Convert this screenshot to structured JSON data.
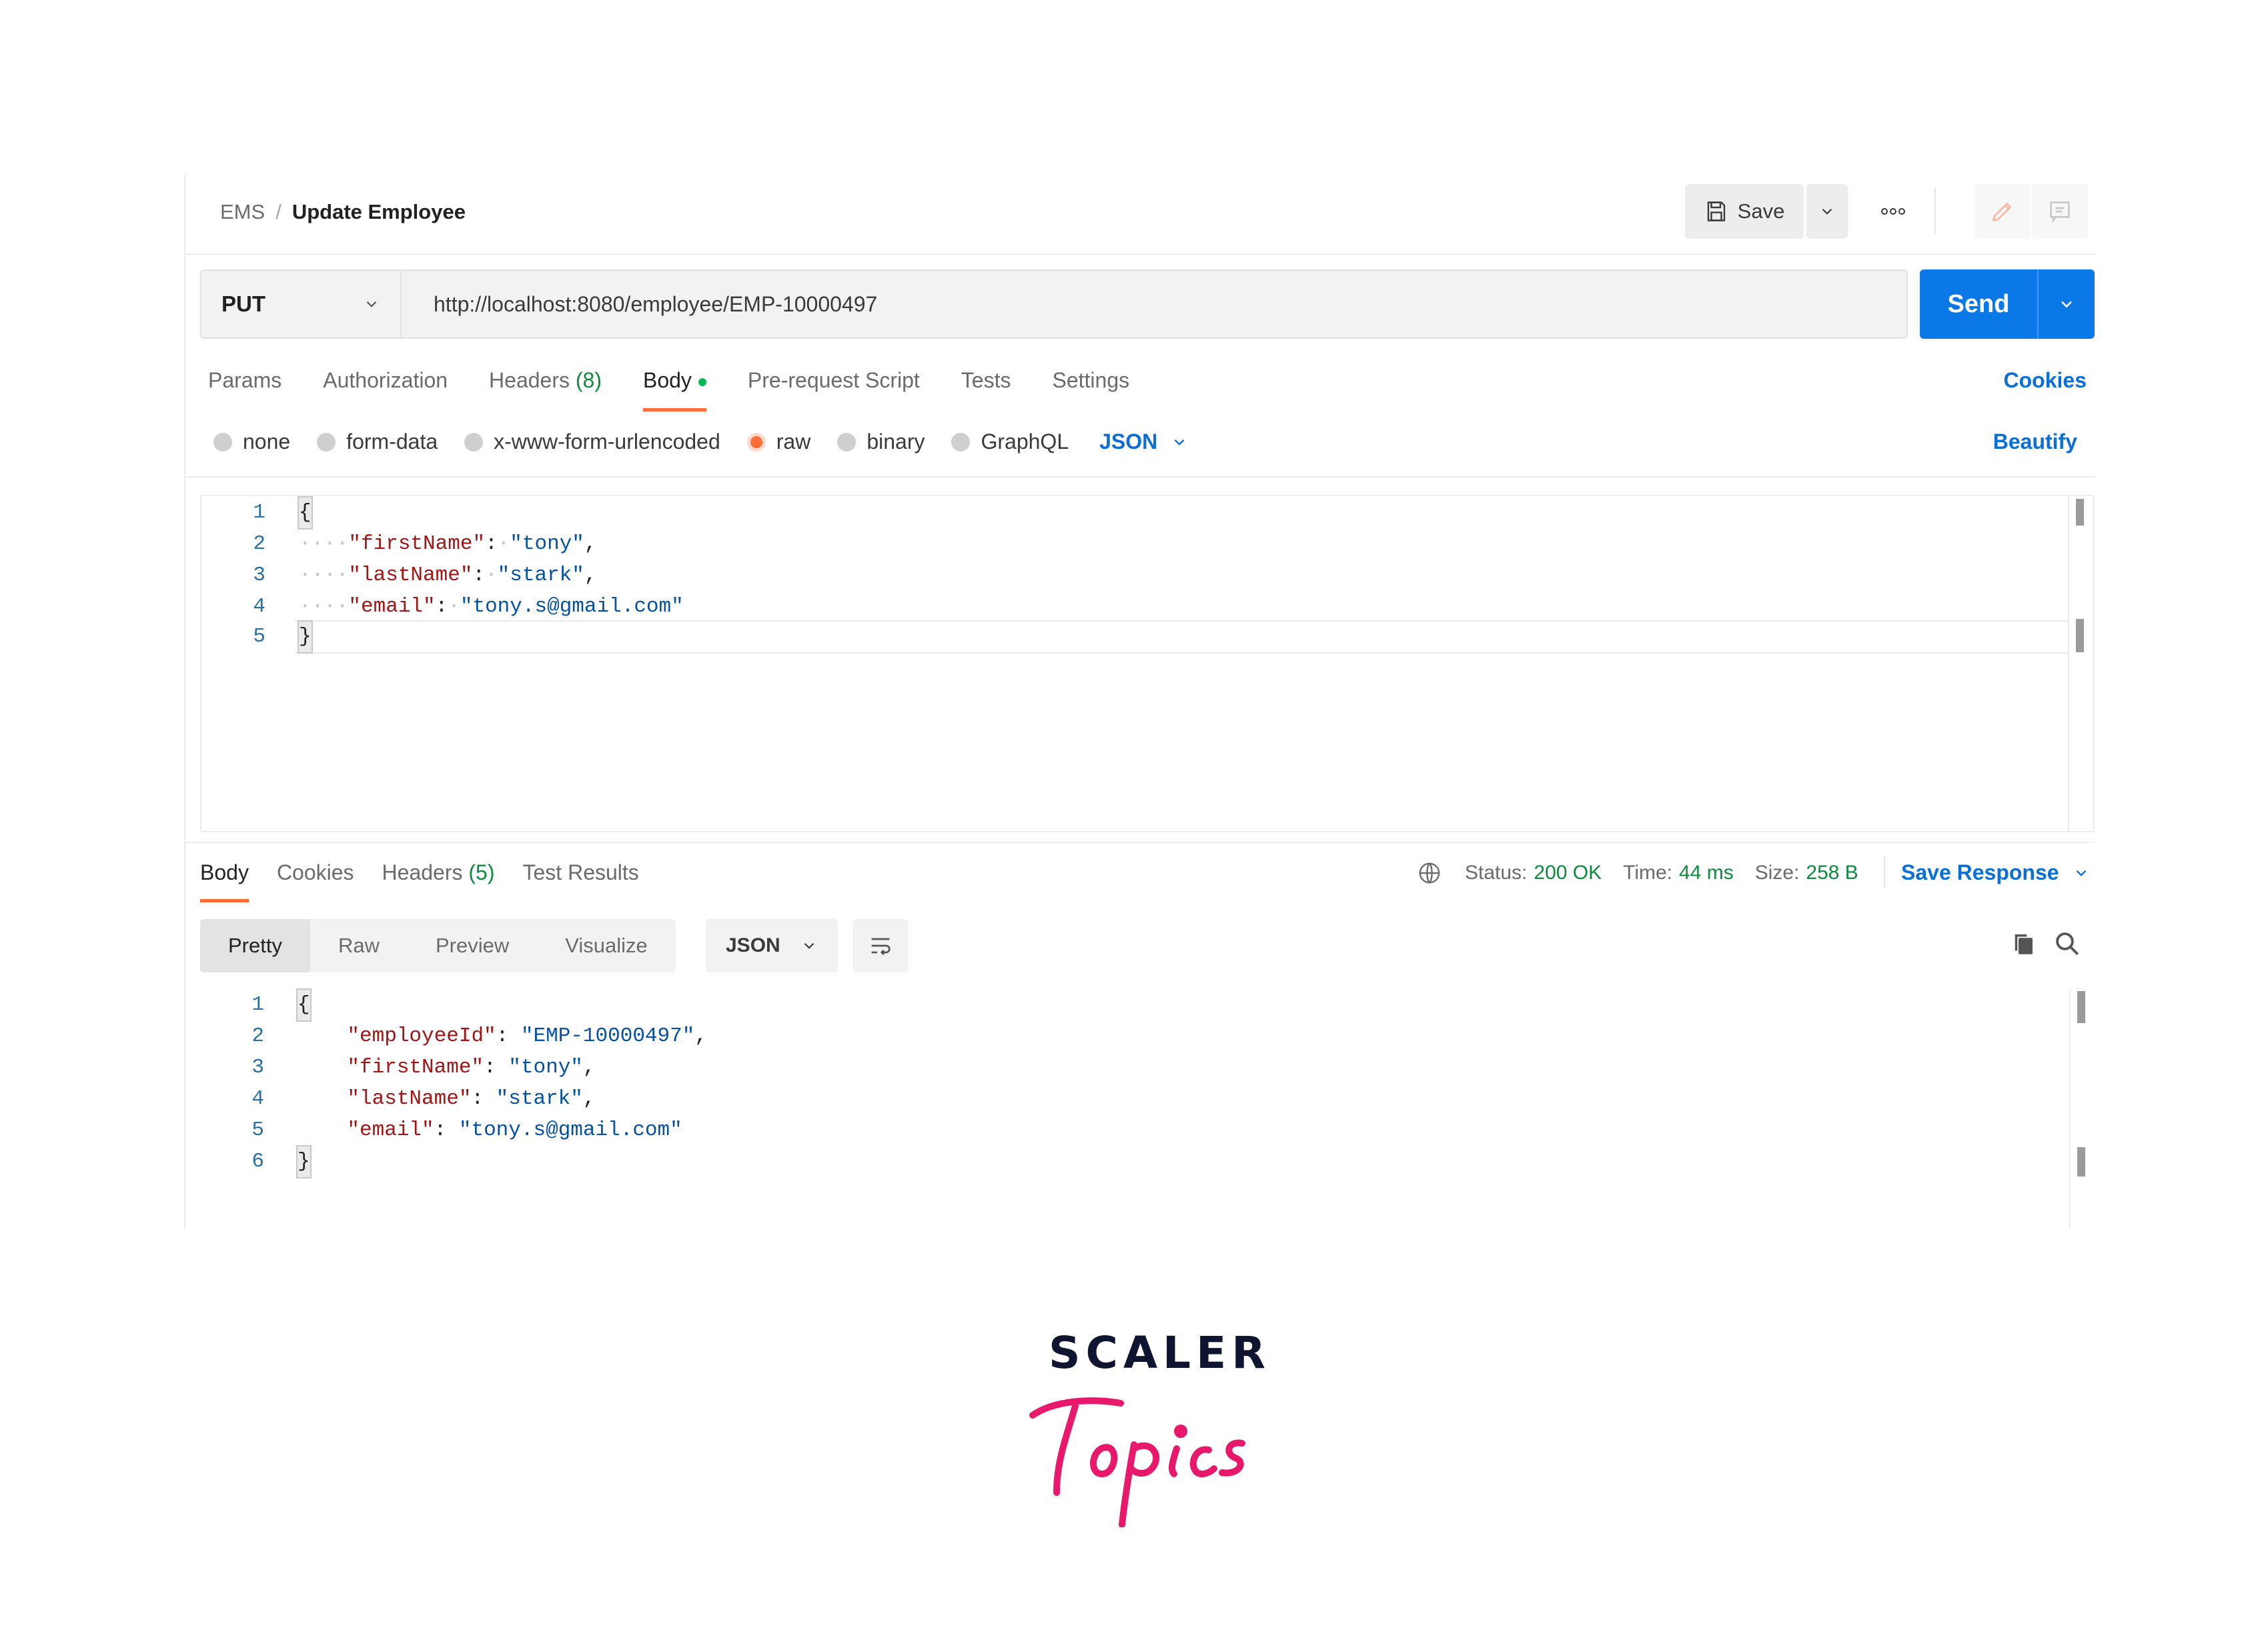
{
  "breadcrumb": {
    "collection": "EMS",
    "separator": "/",
    "request": "Update Employee"
  },
  "header": {
    "save_label": "Save"
  },
  "request": {
    "method": "PUT",
    "url": "http://localhost:8080/employee/EMP-10000497",
    "send_label": "Send"
  },
  "tabs": {
    "params": "Params",
    "authorization": "Authorization",
    "headers": "Headers",
    "headers_count": "(8)",
    "body": "Body",
    "pre_request": "Pre-request Script",
    "tests": "Tests",
    "settings": "Settings",
    "cookies": "Cookies"
  },
  "body_types": {
    "none": "none",
    "form_data": "form-data",
    "urlencoded": "x-www-form-urlencoded",
    "raw": "raw",
    "binary": "binary",
    "graphql": "GraphQL",
    "format": "JSON",
    "selected": "raw",
    "beautify": "Beautify"
  },
  "request_body": {
    "line_numbers": [
      "1",
      "2",
      "3",
      "4",
      "5"
    ],
    "open": "{",
    "close": "}",
    "k1": "\"firstName\"",
    "v1": "\"tony\"",
    "k2": "\"lastName\"",
    "v2": "\"stark\"",
    "k3": "\"email\"",
    "v3": "\"tony.s@gmail.com\""
  },
  "response": {
    "tabs": {
      "body": "Body",
      "cookies": "Cookies",
      "headers": "Headers",
      "headers_count": "(5)",
      "test_results": "Test Results"
    },
    "status_label": "Status:",
    "status_value": "200 OK",
    "time_label": "Time:",
    "time_value": "44 ms",
    "size_label": "Size:",
    "size_value": "258 B",
    "save_response": "Save Response",
    "views": {
      "pretty": "Pretty",
      "raw": "Raw",
      "preview": "Preview",
      "visualize": "Visualize"
    },
    "format": "JSON",
    "body": {
      "line_numbers": [
        "1",
        "2",
        "3",
        "4",
        "5",
        "6"
      ],
      "open": "{",
      "close": "}",
      "k0": "\"employeeId\"",
      "v0": "\"EMP-10000497\"",
      "k1": "\"firstName\"",
      "v1": "\"tony\"",
      "k2": "\"lastName\"",
      "v2": "\"stark\"",
      "k3": "\"email\"",
      "v3": "\"tony.s@gmail.com\""
    }
  },
  "logo": {
    "line1": "SCALER",
    "line2": "Topics"
  },
  "colors": {
    "accent": "#ff6c37",
    "send_blue": "#0b78e8",
    "link_blue": "#0b6fd6",
    "status_green": "#0d8a3c",
    "logo_pink": "#e8186a",
    "logo_navy": "#0f1530"
  },
  "icons": [
    "save-icon",
    "chevron-down-icon",
    "more-options-icon",
    "edit-icon",
    "comment-icon",
    "globe-icon",
    "wrap-lines-icon",
    "copy-icon",
    "search-icon"
  ]
}
